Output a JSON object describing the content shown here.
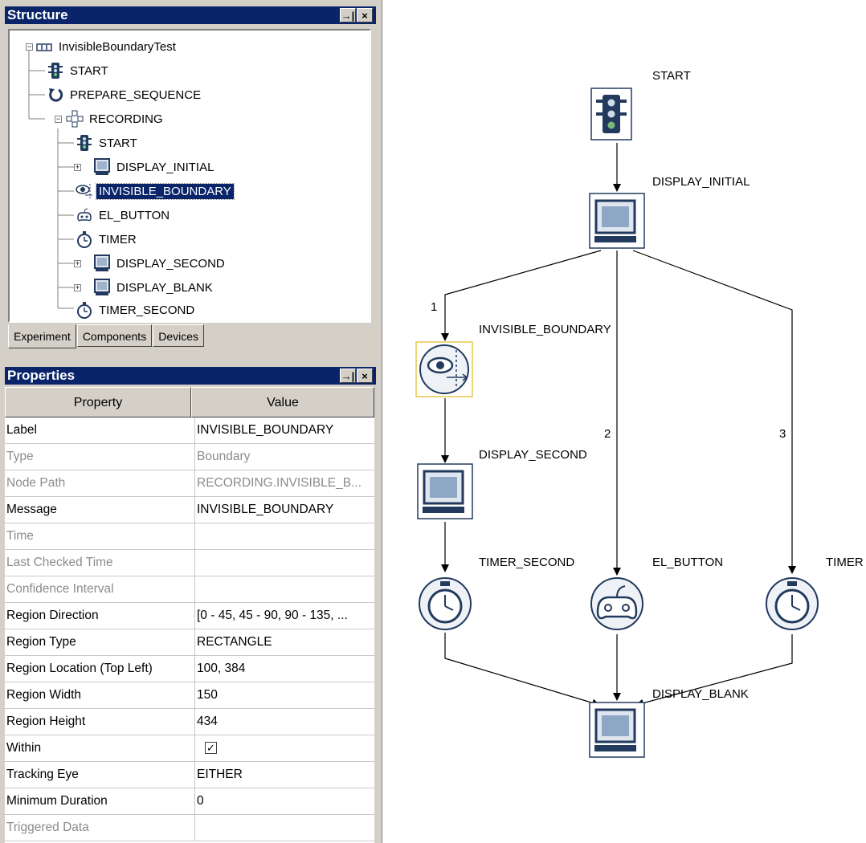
{
  "structure_panel": {
    "title": "Structure",
    "pin_glyph": "→|",
    "close_glyph": "×",
    "tree": [
      {
        "label": "InvisibleBoundaryTest",
        "icon": "experiment-icon",
        "selected": false
      },
      {
        "label": "START",
        "icon": "traffic-light-icon",
        "selected": false
      },
      {
        "label": "PREPARE_SEQUENCE",
        "icon": "refresh-icon",
        "selected": false
      },
      {
        "label": "RECORDING",
        "icon": "recording-nodes-icon",
        "selected": false
      },
      {
        "label": "START",
        "icon": "traffic-light-icon",
        "selected": false
      },
      {
        "label": "DISPLAY_INITIAL",
        "icon": "monitor-icon",
        "selected": false
      },
      {
        "label": "INVISIBLE_BOUNDARY",
        "icon": "eye-boundary-icon",
        "selected": true
      },
      {
        "label": "EL_BUTTON",
        "icon": "gamepad-icon",
        "selected": false
      },
      {
        "label": "TIMER",
        "icon": "stopwatch-icon",
        "selected": false
      },
      {
        "label": "DISPLAY_SECOND",
        "icon": "monitor-icon",
        "selected": false
      },
      {
        "label": "DISPLAY_BLANK",
        "icon": "monitor-icon",
        "selected": false
      },
      {
        "label": "TIMER_SECOND",
        "icon": "stopwatch-icon",
        "selected": false
      }
    ],
    "tabs": [
      "Experiment",
      "Components",
      "Devices"
    ],
    "active_tab": "Experiment"
  },
  "properties_panel": {
    "title": "Properties",
    "pin_glyph": "→|",
    "close_glyph": "×",
    "columns": [
      "Property",
      "Value"
    ],
    "rows": [
      {
        "name": "Label",
        "value": "INVISIBLE_BOUNDARY",
        "enabled": true
      },
      {
        "name": "Type",
        "value": "Boundary",
        "enabled": false
      },
      {
        "name": "Node Path",
        "value": "RECORDING.INVISIBLE_B...",
        "enabled": false
      },
      {
        "name": "Message",
        "value": "INVISIBLE_BOUNDARY",
        "enabled": true
      },
      {
        "name": "Time",
        "value": "",
        "enabled": false
      },
      {
        "name": "Last Checked Time",
        "value": "",
        "enabled": false
      },
      {
        "name": "Confidence Interval",
        "value": "",
        "enabled": false
      },
      {
        "name": "Region Direction",
        "value": "[0 - 45, 45 - 90, 90 - 135, ...",
        "enabled": true
      },
      {
        "name": "Region Type",
        "value": "RECTANGLE",
        "enabled": true
      },
      {
        "name": "Region Location (Top Left)",
        "value": "100, 384",
        "enabled": true
      },
      {
        "name": "Region Width",
        "value": "150",
        "enabled": true
      },
      {
        "name": "Region Height",
        "value": "434",
        "enabled": true
      },
      {
        "name": "Within",
        "value": "",
        "checkbox": true,
        "checked": true,
        "enabled": true
      },
      {
        "name": "Tracking Eye",
        "value": "EITHER",
        "enabled": true
      },
      {
        "name": "Minimum Duration",
        "value": "0",
        "enabled": true
      },
      {
        "name": "Triggered Data",
        "value": "",
        "enabled": false
      }
    ]
  },
  "diagram": {
    "nodes": [
      {
        "id": "start",
        "label": "START",
        "icon": "traffic-light-icon"
      },
      {
        "id": "display_initial",
        "label": "DISPLAY_INITIAL",
        "icon": "monitor-icon"
      },
      {
        "id": "invisible_boundary",
        "label": "INVISIBLE_BOUNDARY",
        "icon": "eye-boundary-icon",
        "selected": true
      },
      {
        "id": "display_second",
        "label": "DISPLAY_SECOND",
        "icon": "monitor-icon"
      },
      {
        "id": "timer_second",
        "label": "TIMER_SECOND",
        "icon": "stopwatch-icon"
      },
      {
        "id": "el_button",
        "label": "EL_BUTTON",
        "icon": "gamepad-icon"
      },
      {
        "id": "timer",
        "label": "TIMER",
        "icon": "stopwatch-icon"
      },
      {
        "id": "display_blank",
        "label": "DISPLAY_BLANK",
        "icon": "monitor-icon"
      }
    ],
    "edge_labels": [
      "1",
      "2",
      "3"
    ]
  }
}
